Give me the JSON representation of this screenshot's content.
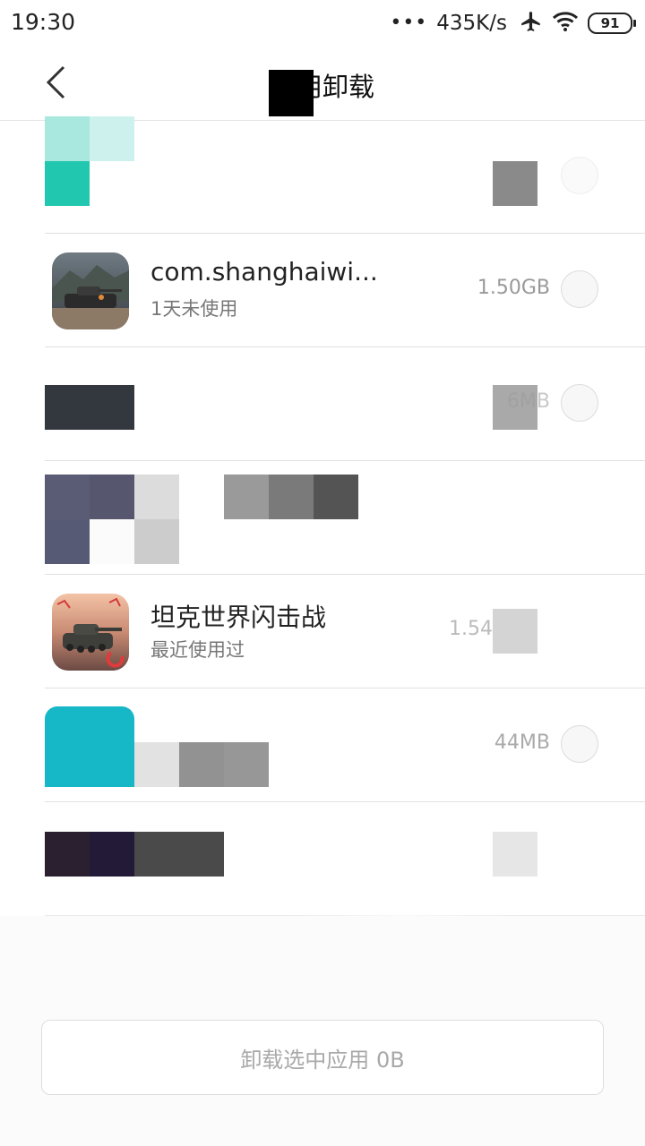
{
  "status_bar": {
    "time": "19:30",
    "dots": "•••",
    "network_speed": "435K/s",
    "icons": [
      "airplane-icon",
      "wifi-icon",
      "battery-icon"
    ],
    "battery": "91"
  },
  "header": {
    "title": "应用卸载",
    "back_icon": "chevron-left-icon"
  },
  "apps": [
    {
      "name": "",
      "status": "",
      "size": "",
      "icon": "redacted"
    },
    {
      "name": "com.shanghaiwi...",
      "status": "1天未使用",
      "size": "1.50GB",
      "icon": "game-tank-icon"
    },
    {
      "name": "",
      "status": "",
      "size": "6MB",
      "icon": "redacted"
    },
    {
      "name": "",
      "status": "",
      "size": "",
      "icon": "redacted"
    },
    {
      "name": "坦克世界闪击战",
      "status": "最近使用过",
      "size": "1.54",
      "icon": "world-of-tanks-blitz-icon"
    },
    {
      "name": "",
      "status": "",
      "size": "44MB",
      "icon": "cyan-app-icon"
    },
    {
      "name": "",
      "status": "",
      "size": "",
      "icon": "redacted"
    }
  ],
  "bottom": {
    "uninstall_label": "卸载选中应用 0B"
  },
  "colors": {
    "text_primary": "#222222",
    "text_secondary": "#777777",
    "size_text": "#999999",
    "button_text": "#a9a9a9",
    "divider": "#e0e0e0"
  }
}
